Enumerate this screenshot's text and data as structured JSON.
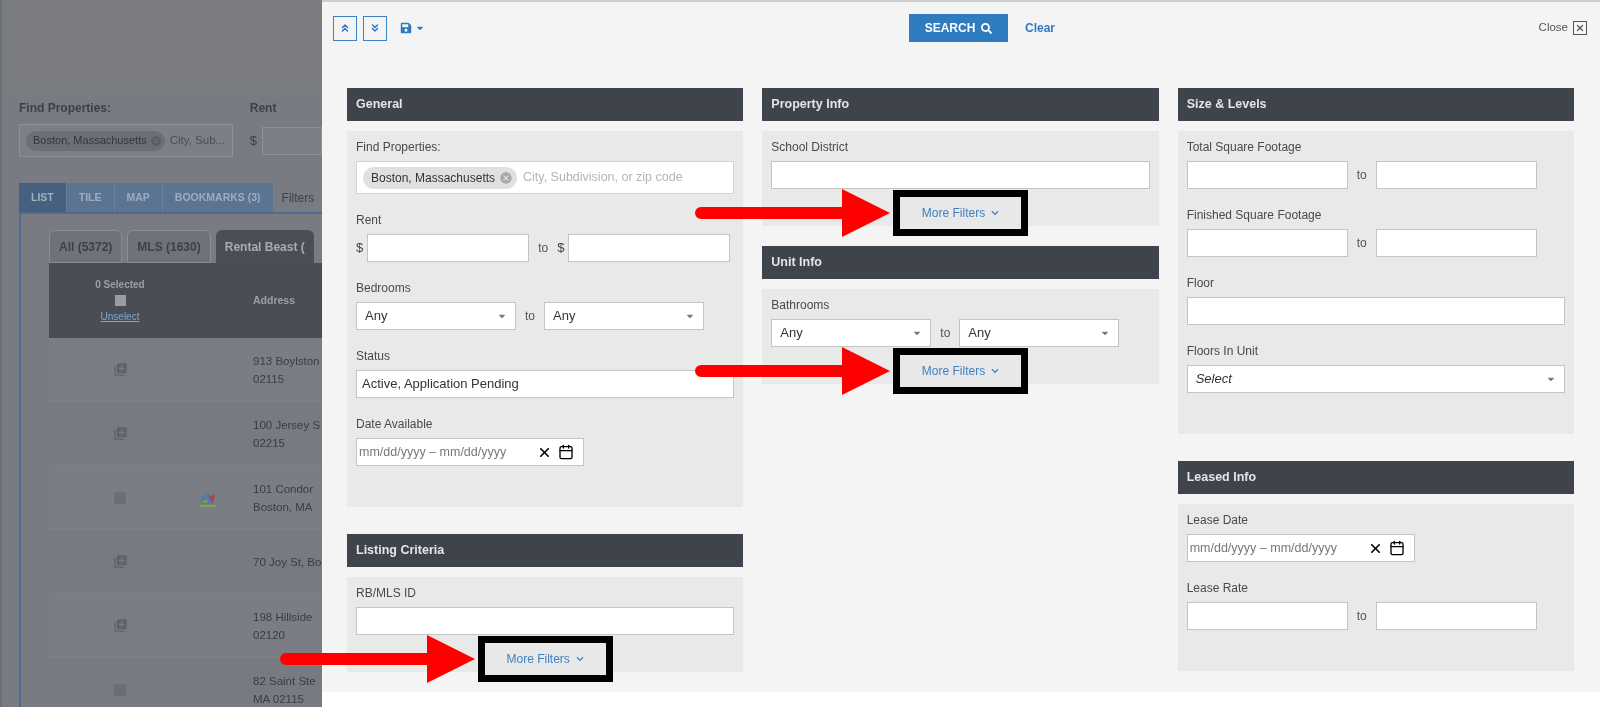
{
  "background": {
    "find_label": "Find Properties:",
    "chip": "Boston, Massachusetts",
    "placeholder": "City, Sub...",
    "rent_label": "Rent",
    "currency": "$",
    "view_tabs": [
      {
        "label": "LIST",
        "selected": true
      },
      {
        "label": "TILE",
        "selected": false
      },
      {
        "label": "MAP",
        "selected": false
      },
      {
        "label": "BOOKMARKS (3)",
        "selected": false
      }
    ],
    "filters_label": "Filters",
    "source_tabs": [
      {
        "label": "All (5372)",
        "selected": false
      },
      {
        "label": "MLS (1630)",
        "selected": false
      },
      {
        "label": "Rental Beast (",
        "selected": true
      }
    ],
    "table": {
      "selected_count": "0 Selected",
      "select_all_checked": false,
      "unselect": "Unselect",
      "address_header": "Address",
      "rows": [
        {
          "kind": "add",
          "verified": false,
          "lines": [
            "913 Boylston",
            "02115"
          ]
        },
        {
          "kind": "add",
          "verified": false,
          "lines": [
            "100 Jersey S",
            "02215"
          ]
        },
        {
          "kind": "checkbox",
          "checked": false,
          "verified": true,
          "lines": [
            "101 Condor",
            "Boston, MA"
          ]
        },
        {
          "kind": "add",
          "verified": false,
          "lines": [
            "70 Joy St, Bo"
          ]
        },
        {
          "kind": "add",
          "verified": false,
          "lines": [
            "198 Hillside",
            "02120"
          ]
        },
        {
          "kind": "checkbox",
          "checked": false,
          "verified": false,
          "lines": [
            "82 Saint Ste",
            "MA 02115"
          ]
        }
      ]
    }
  },
  "toolbar": {
    "search": "SEARCH",
    "clear": "Clear",
    "close": "Close"
  },
  "columns": [
    [
      {
        "title": "General",
        "fields": [
          {
            "kind": "tags",
            "label": "Find Properties:",
            "chip": "Boston, Massachusetts",
            "placeholder": "City, Subdivision, or zip code"
          },
          {
            "kind": "money-range",
            "label": "Rent",
            "prefix_from": "$",
            "joiner": "to",
            "prefix_to": "$"
          },
          {
            "kind": "select-range",
            "label": "Bedrooms",
            "from": "Any",
            "joiner": "to",
            "to": "Any"
          },
          {
            "kind": "multi",
            "label": "Status",
            "value": "Active, Application Pending"
          },
          {
            "kind": "date-range",
            "label": "Date Available",
            "placeholder": "mm/dd/yyyy – mm/dd/yyyy"
          }
        ]
      },
      {
        "title": "Listing Criteria",
        "fields": [
          {
            "kind": "text",
            "label": "RB/MLS ID"
          }
        ],
        "more_filters": {
          "label": "More Filters",
          "highlighted": true
        }
      }
    ],
    [
      {
        "title": "Property Info",
        "fields": [
          {
            "kind": "text",
            "label": "School District"
          }
        ],
        "more_filters": {
          "label": "More Filters",
          "highlighted": true
        }
      },
      {
        "title": "Unit Info",
        "fields": [
          {
            "kind": "select-range",
            "label": "Bathrooms",
            "from": "Any",
            "joiner": "to",
            "to": "Any"
          }
        ],
        "more_filters": {
          "label": "More Filters",
          "highlighted": true
        }
      }
    ],
    [
      {
        "title": "Size & Levels",
        "fields": [
          {
            "kind": "range",
            "label": "Total Square Footage",
            "joiner": "to"
          },
          {
            "kind": "range",
            "label": "Finished Square Footage",
            "joiner": "to"
          },
          {
            "kind": "text",
            "label": "Floor"
          },
          {
            "kind": "select",
            "label": "Floors In Unit",
            "placeholder": "Select"
          }
        ]
      },
      {
        "title": "Leased Info",
        "fields": [
          {
            "kind": "date-range",
            "label": "Lease Date",
            "placeholder": "mm/dd/yyyy – mm/dd/yyyy"
          },
          {
            "kind": "range",
            "label": "Lease Rate",
            "joiner": "to"
          }
        ]
      }
    ]
  ]
}
